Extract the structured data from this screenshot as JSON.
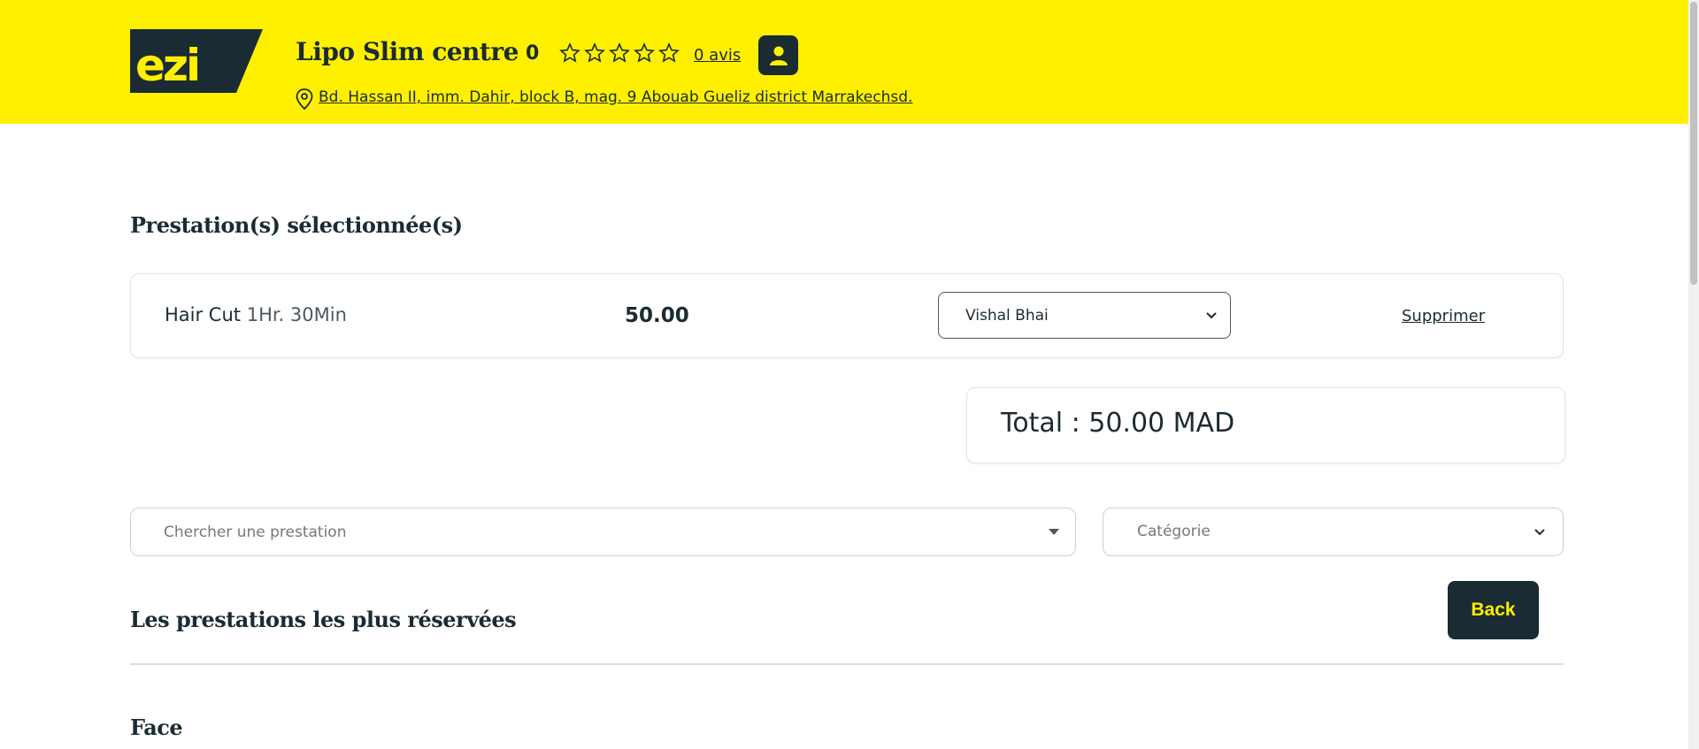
{
  "header": {
    "logo_text": "ezi",
    "shop_name": "Lipo Slim centre",
    "rating_value": "0",
    "rating_stars": 0,
    "rating_max": 5,
    "reviews_label": "0 avis",
    "address": " Bd. Hassan II, imm. Dahir, block B, mag. 9 Abouab Gueliz district Marrakechsd.",
    "user_icon": "user-icon",
    "address_icon": "map-pin-icon"
  },
  "selected": {
    "title": "Prestation(s) sélectionnée(s)",
    "items": [
      {
        "name": "Hair Cut",
        "duration": "1Hr. 30Min",
        "price": "50.00",
        "staff": "Vishal Bhai",
        "delete_label": "Supprimer"
      }
    ],
    "total_label": "Total : 50.00 MAD"
  },
  "search": {
    "placeholder": "Chercher une prestation",
    "category_placeholder": "Catégorie"
  },
  "popular": {
    "title": "Les prestations les plus réservées",
    "back_label": "Back"
  },
  "face": {
    "title": "Face"
  },
  "colors": {
    "brand_yellow": "#fff000",
    "brand_dark": "#1b2b33"
  }
}
